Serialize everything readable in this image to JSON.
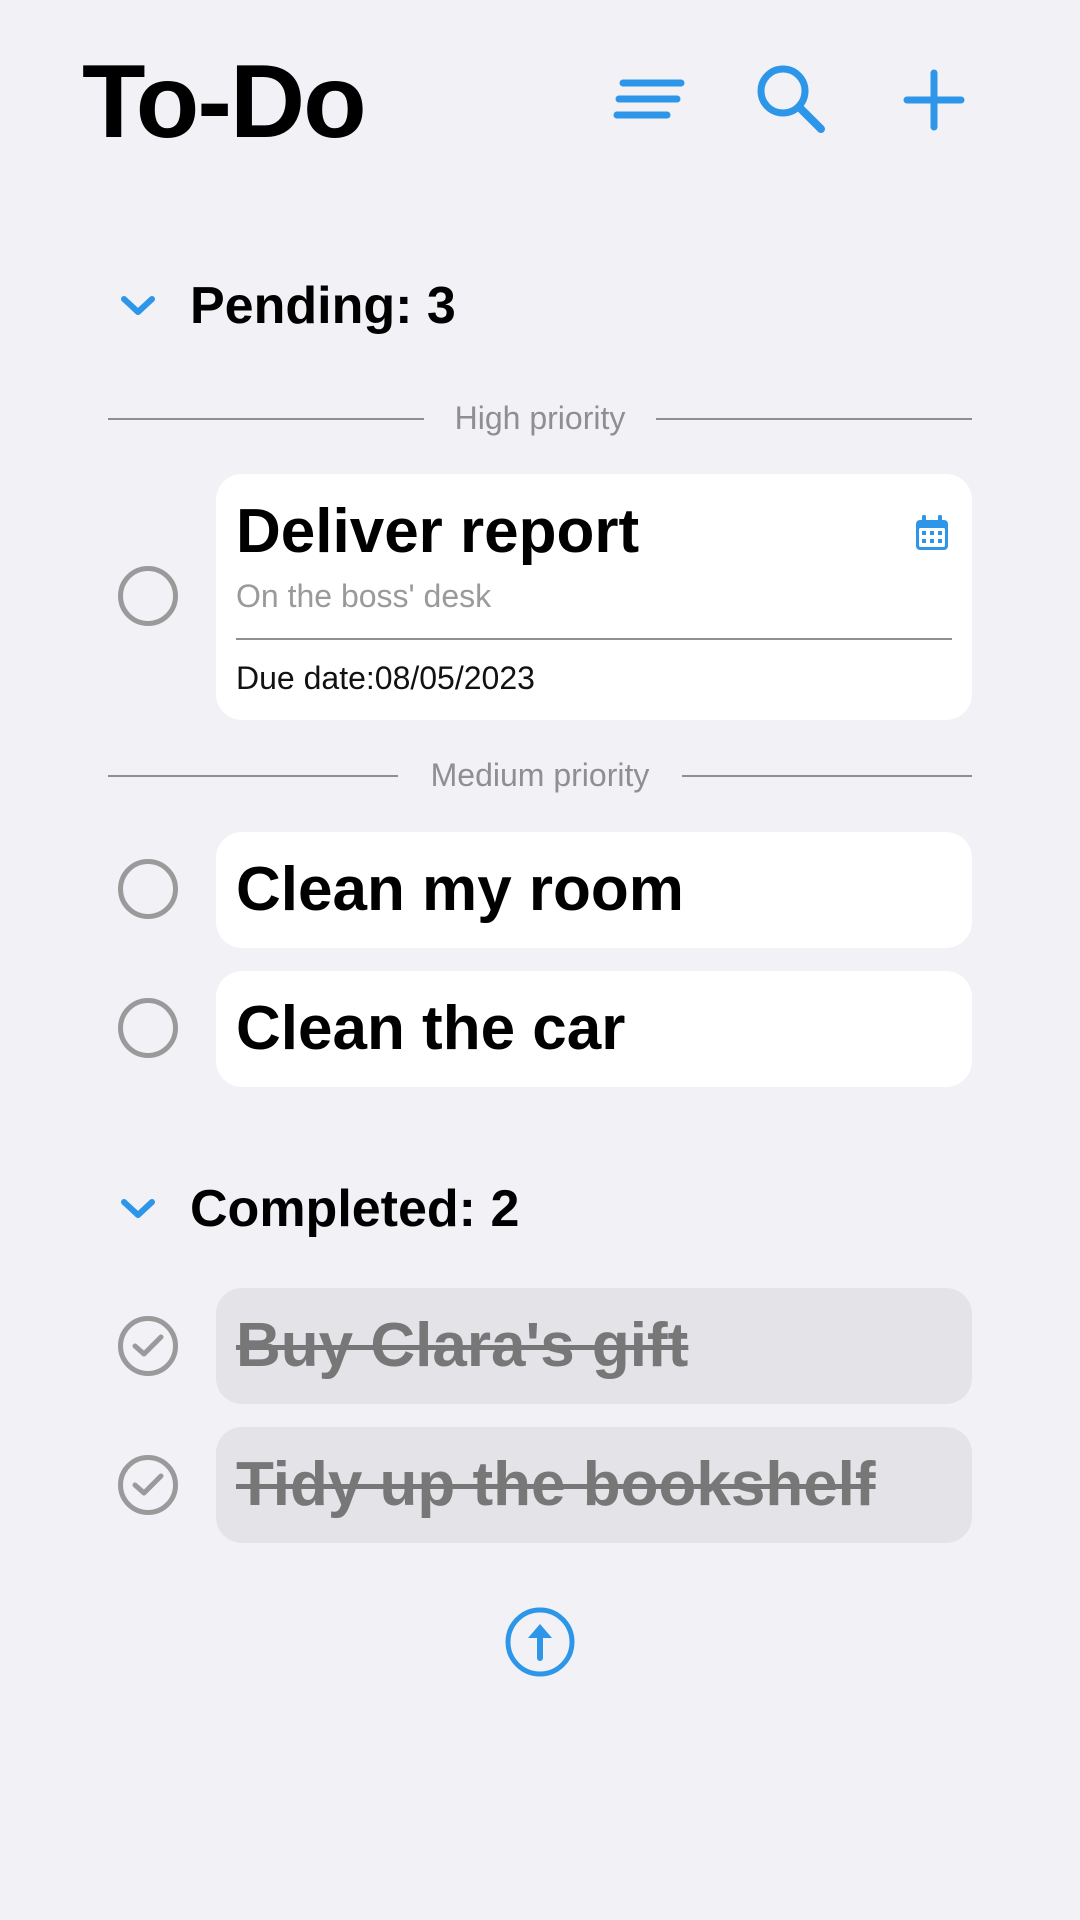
{
  "header": {
    "title": "To-Do",
    "icons": [
      "sort-lines-icon",
      "search-icon",
      "plus-icon"
    ]
  },
  "accent_color": "#2e96e8",
  "pending": {
    "title": "Pending: 3",
    "groups": [
      {
        "label": "High priority",
        "tasks": [
          {
            "title": "Deliver report",
            "description": "On the boss' desk",
            "due_label": "Due date:",
            "due_value": "08/05/2023",
            "icon": "calendar-icon"
          }
        ]
      },
      {
        "label": "Medium priority",
        "tasks": [
          {
            "title": "Clean my room"
          },
          {
            "title": "Clean the car"
          }
        ]
      }
    ]
  },
  "completed": {
    "title": "Completed: 2",
    "tasks": [
      {
        "title": "Buy Clara's gift"
      },
      {
        "title": "Tidy up the bookshelf"
      }
    ]
  },
  "footer": {
    "icon": "arrow-up-circle-icon"
  }
}
